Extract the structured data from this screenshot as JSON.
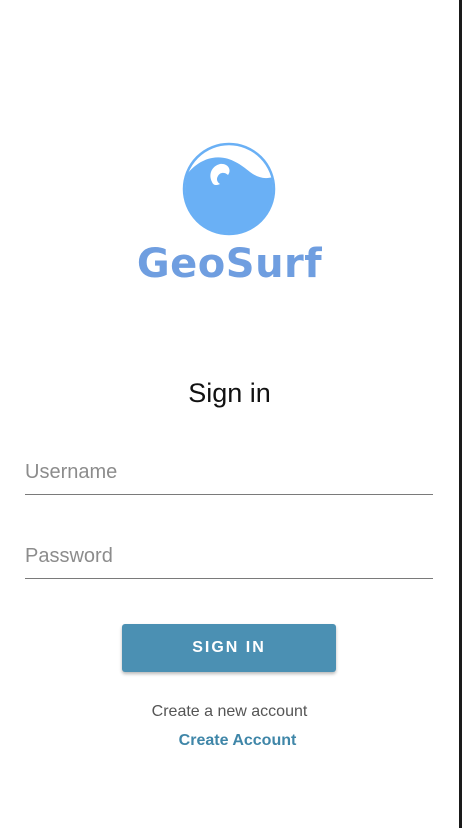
{
  "brand": {
    "name": "GeoSurf",
    "logo_icon": "wave-logo-icon",
    "color": "#6f9ee0"
  },
  "form": {
    "title": "Sign in",
    "username_placeholder": "Username",
    "password_placeholder": "Password",
    "submit_label": "SIGN IN"
  },
  "footer": {
    "prompt_text": "Create a new account",
    "link_label": "Create Account"
  },
  "colors": {
    "primary_button": "#4b90b3",
    "link": "#3f86a8"
  }
}
